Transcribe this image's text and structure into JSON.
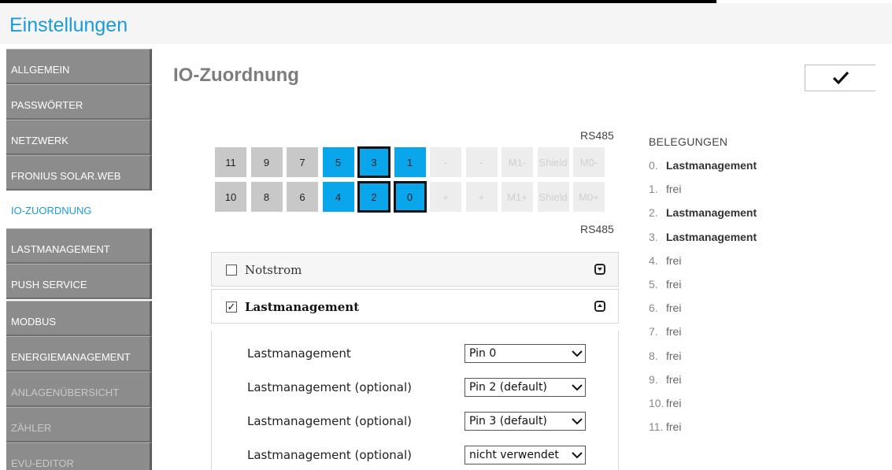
{
  "app": {
    "title": "Einstellungen"
  },
  "sidebar": {
    "items": [
      {
        "label": "ALLGEMEIN",
        "state": "normal"
      },
      {
        "label": "PASSWÖRTER",
        "state": "normal"
      },
      {
        "label": "NETZWERK",
        "state": "normal"
      },
      {
        "label": "FRONIUS SOLAR.WEB",
        "state": "normal"
      },
      {
        "label": "IO-ZUORDNUNG",
        "state": "active"
      },
      {
        "label": "LASTMANAGEMENT",
        "state": "normal"
      },
      {
        "label": "PUSH SERVICE",
        "state": "normal"
      },
      {
        "label": "MODBUS",
        "state": "normal"
      },
      {
        "label": "ENERGIEMANAGEMENT",
        "state": "normal"
      },
      {
        "label": "ANLAGENÜBERSICHT",
        "state": "dim"
      },
      {
        "label": "ZÄHLER",
        "state": "dim"
      },
      {
        "label": "EVU-EDITOR",
        "state": "dim"
      }
    ]
  },
  "main": {
    "title": "IO-Zuordnung",
    "save_icon": "checkmark-icon"
  },
  "connector": {
    "top_label": "RS485",
    "bottom_label": "RS485",
    "row_top": [
      {
        "label": "11",
        "style": "gray"
      },
      {
        "label": "9",
        "style": "gray"
      },
      {
        "label": "7",
        "style": "gray"
      },
      {
        "label": "5",
        "style": "blue"
      },
      {
        "label": "3",
        "style": "blue-selected"
      },
      {
        "label": "1",
        "style": "blue"
      },
      {
        "label": "-",
        "style": "disabled"
      },
      {
        "label": "-",
        "style": "disabled"
      },
      {
        "label": "M1-",
        "style": "disabled"
      },
      {
        "label": "Shield",
        "style": "disabled"
      },
      {
        "label": "M0-",
        "style": "disabled"
      }
    ],
    "row_bottom": [
      {
        "label": "10",
        "style": "gray"
      },
      {
        "label": "8",
        "style": "gray"
      },
      {
        "label": "6",
        "style": "gray"
      },
      {
        "label": "4",
        "style": "blue"
      },
      {
        "label": "2",
        "style": "blue-selected"
      },
      {
        "label": "0",
        "style": "blue-selected"
      },
      {
        "label": "+",
        "style": "disabled"
      },
      {
        "label": "+",
        "style": "disabled"
      },
      {
        "label": "M1+",
        "style": "disabled"
      },
      {
        "label": "Shield",
        "style": "disabled"
      },
      {
        "label": "M0+",
        "style": "disabled"
      }
    ]
  },
  "panels": {
    "notstrom": {
      "label": "Notstrom",
      "checked": false,
      "expanded": false
    },
    "lastmanagement": {
      "label": "Lastmanagement",
      "checked": true,
      "expanded": true
    }
  },
  "lastmanagement_fields": [
    {
      "label": "Lastmanagement",
      "value": "Pin 0"
    },
    {
      "label": "Lastmanagement (optional)",
      "value": "Pin 2 (default)"
    },
    {
      "label": "Lastmanagement (optional)",
      "value": "Pin 3 (default)"
    },
    {
      "label": "Lastmanagement (optional)",
      "value": "nicht verwendet"
    }
  ],
  "belegungen": {
    "title": "BELEGUNGEN",
    "items": [
      {
        "num": "0.",
        "value": "Lastmanagement",
        "bold": true
      },
      {
        "num": "1.",
        "value": "frei",
        "bold": false
      },
      {
        "num": "2.",
        "value": "Lastmanagement",
        "bold": true
      },
      {
        "num": "3.",
        "value": "Lastmanagement",
        "bold": true
      },
      {
        "num": "4.",
        "value": "frei",
        "bold": false
      },
      {
        "num": "5.",
        "value": "frei",
        "bold": false
      },
      {
        "num": "6.",
        "value": "frei",
        "bold": false
      },
      {
        "num": "7.",
        "value": "frei",
        "bold": false
      },
      {
        "num": "8.",
        "value": "frei",
        "bold": false
      },
      {
        "num": "9.",
        "value": "frei",
        "bold": false
      },
      {
        "num": "10.",
        "value": "frei",
        "bold": false
      },
      {
        "num": "11.",
        "value": "frei",
        "bold": false
      }
    ]
  },
  "colors": {
    "accent": "#1a9bd7",
    "pin_blue": "#0aa6ec",
    "pin_gray": "#c8c8c8",
    "nav_gray": "#8c8c8c"
  }
}
